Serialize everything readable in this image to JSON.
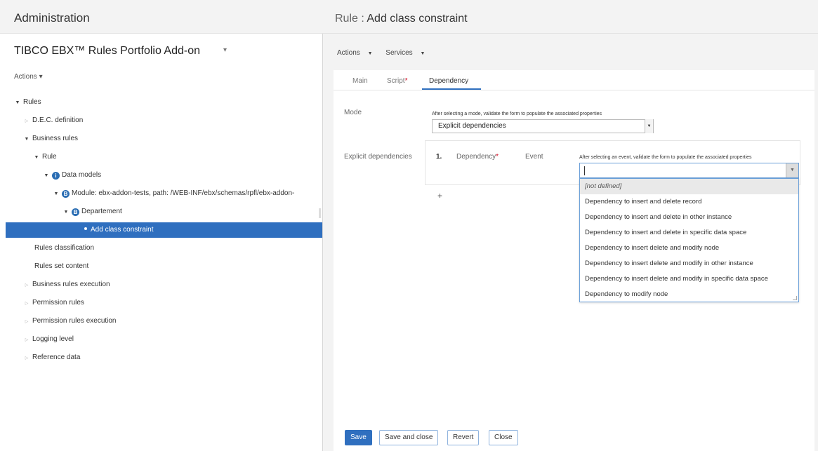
{
  "left": {
    "header_title": "Administration",
    "dataset_title": "TIBCO EBX™ Rules Portfolio Add-on",
    "dataset_caret": "▾",
    "actions_label": "Actions ▾"
  },
  "tree": {
    "rules": "Rules",
    "dec_definition": "D.E.C. definition",
    "business_rules": "Business rules",
    "rule": "Rule",
    "data_models": "Data models",
    "module": "Module: ebx-addon-tests, path: /WEB-INF/ebx/schemas/rpfl/ebx-addon-",
    "departement": "Departement",
    "add_class_constraint": "Add class constraint",
    "rules_classification": "Rules classification",
    "rules_set_content": "Rules set content",
    "business_rules_execution": "Business rules execution",
    "permission_rules": "Permission rules",
    "permission_rules_execution": "Permission rules execution",
    "logging_level": "Logging level",
    "reference_data": "Reference data",
    "badge_data_models": "i",
    "badge_module": "B",
    "badge_departement": "B"
  },
  "right": {
    "title_prefix": "Rule",
    "title_sep": ":",
    "title_main": "Add class constraint",
    "toolbar": {
      "actions": "Actions",
      "services": "Services"
    }
  },
  "tabs": {
    "main": "Main",
    "script": "Script",
    "dependency": "Dependency",
    "required_mark": "*"
  },
  "form": {
    "mode_label": "Mode",
    "mode_help": "After selecting a mode, validate the form to populate the associated properties",
    "mode_value": "Explicit dependencies",
    "explicit_label": "Explicit dependencies",
    "item_index": "1.",
    "dependency_label": "Dependency",
    "event_label": "Event",
    "event_help": "After selecting an event, validate the form to populate the associated properties",
    "add_symbol": "+"
  },
  "event_options": [
    "[not defined]",
    "Dependency to insert and delete record",
    "Dependency to insert and delete in other instance",
    "Dependency to insert and delete in specific data space",
    "Dependency to insert delete and modify node",
    "Dependency to insert delete and modify in other instance",
    "Dependency to insert delete and modify in specific data space",
    "Dependency to modify node"
  ],
  "buttons": {
    "save": "Save",
    "save_close": "Save and close",
    "revert": "Revert",
    "close": "Close"
  },
  "colors": {
    "accent": "#2f6fbf",
    "panel_bg": "#f3f3f3",
    "required": "#d0021b"
  }
}
